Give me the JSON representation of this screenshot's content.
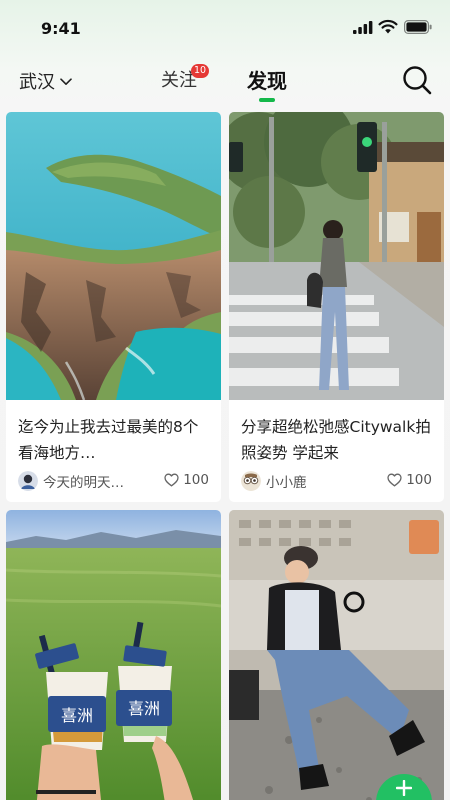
{
  "status_bar": {
    "time": "9:41"
  },
  "nav": {
    "city": "武汉",
    "tabs": [
      {
        "label": "关注",
        "badge": "10"
      },
      {
        "label": "发现",
        "active": true
      }
    ]
  },
  "feed": [
    {
      "title": "迄今为止我去过最美的8个看海地方…",
      "author": "今天的明天…",
      "likes": "100",
      "image": "coastal-cliffs-sea"
    },
    {
      "title": "分享超绝松弛感Citywalk拍照姿势  学起来",
      "author": "小小鹿",
      "likes": "100",
      "image": "street-crosswalk-girl"
    },
    {
      "title": "",
      "author": "",
      "likes": "",
      "image": "grassland-drink-cups",
      "cup_text": "喜洲"
    },
    {
      "title": "",
      "author": "",
      "likes": "",
      "image": "man-sitting-gravel"
    }
  ],
  "colors": {
    "accent": "#14b84a",
    "badge": "#e53935",
    "fab": "#22c063"
  }
}
